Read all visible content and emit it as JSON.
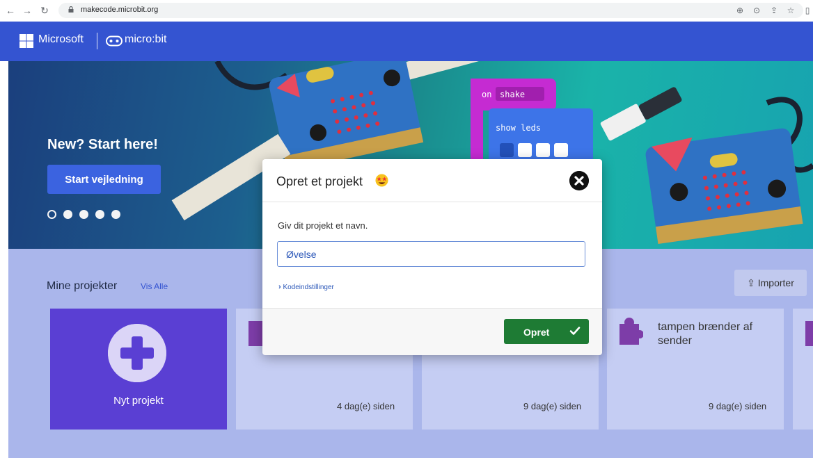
{
  "browser": {
    "url": "makecode.microbit.org"
  },
  "header": {
    "microsoft_label": "Microsoft",
    "microbit_label": "micro:bit"
  },
  "hero": {
    "title": "New? Start here!",
    "start_button": "Start vejledning",
    "carousel_dots": 5,
    "active_dot": 0,
    "code_block_on": "on",
    "code_block_shake": "shake",
    "code_block_show_leds": "show leds"
  },
  "projects": {
    "title": "Mine projekter",
    "view_all": "Vis Alle",
    "import_label": "Importer",
    "new_project": "Nyt projekt",
    "cards": [
      {
        "title": "",
        "age": "4 dag(e) siden"
      },
      {
        "title": "",
        "age": "9 dag(e) siden"
      },
      {
        "title": "tampen brænder af sender",
        "age": "9 dag(e) siden"
      }
    ]
  },
  "modal": {
    "title": "Opret et projekt",
    "prompt": "Giv dit projekt et navn.",
    "name_value": "Øvelse",
    "code_settings": "Kodeindstillinger",
    "create_button": "Opret"
  },
  "colors": {
    "header_blue": "#3454d1",
    "create_green": "#1e7b34",
    "new_card_purple": "#5a3fd3",
    "project_bg": "#aab6eb"
  }
}
